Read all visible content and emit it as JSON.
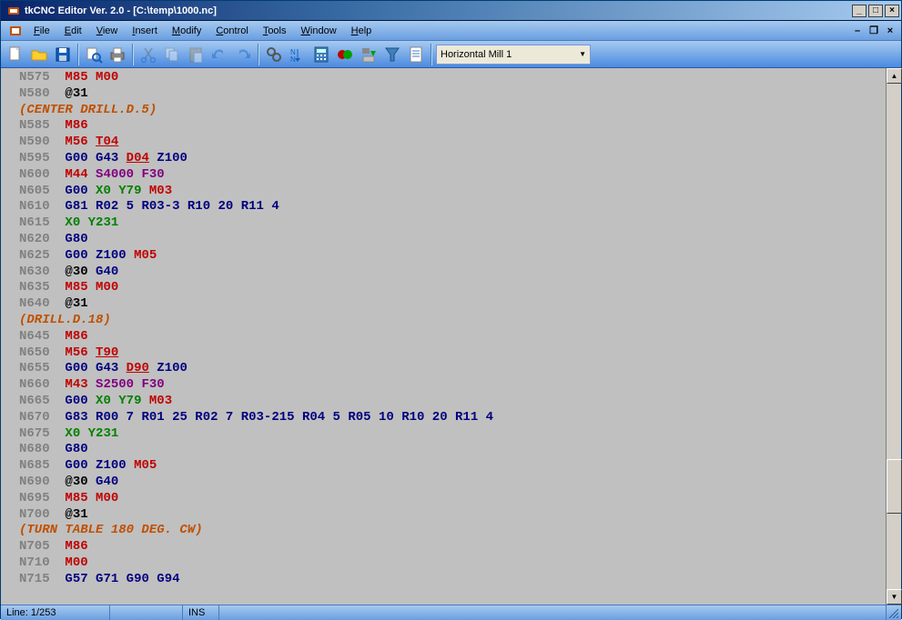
{
  "title": "tkCNC Editor Ver. 2.0 - [C:\\temp\\1000.nc]",
  "menu": {
    "file": "File",
    "edit": "Edit",
    "view": "View",
    "insert": "Insert",
    "modify": "Modify",
    "control": "Control",
    "tools": "Tools",
    "window": "Window",
    "help": "Help"
  },
  "combo": "Horizontal Mill 1",
  "status": {
    "line": "Line: 1/253",
    "ins": "INS"
  },
  "code": [
    [
      [
        "n",
        "N575"
      ],
      [
        "",
        "  "
      ],
      [
        "m",
        "M85"
      ],
      [
        "",
        " "
      ],
      [
        "m",
        "M00"
      ]
    ],
    [
      [
        "n",
        "N580"
      ],
      [
        "",
        "  "
      ],
      [
        "at",
        "@31"
      ]
    ],
    [
      [
        "cmt",
        "(CENTER DRILL.D.5)"
      ]
    ],
    [
      [
        "n",
        "N585"
      ],
      [
        "",
        "  "
      ],
      [
        "m",
        "M86"
      ]
    ],
    [
      [
        "n",
        "N590"
      ],
      [
        "",
        "  "
      ],
      [
        "m",
        "M56"
      ],
      [
        "",
        " "
      ],
      [
        "t",
        "T04"
      ]
    ],
    [
      [
        "n",
        "N595"
      ],
      [
        "",
        "  "
      ],
      [
        "g",
        "G00"
      ],
      [
        "",
        " "
      ],
      [
        "g",
        "G43"
      ],
      [
        "",
        " "
      ],
      [
        "d",
        "D04"
      ],
      [
        "",
        " "
      ],
      [
        "z",
        "Z100"
      ]
    ],
    [
      [
        "n",
        "N600"
      ],
      [
        "",
        "  "
      ],
      [
        "m",
        "M44"
      ],
      [
        "",
        " "
      ],
      [
        "s",
        "S4000"
      ],
      [
        "",
        " "
      ],
      [
        "f",
        "F30"
      ]
    ],
    [
      [
        "n",
        "N605"
      ],
      [
        "",
        "  "
      ],
      [
        "g",
        "G00"
      ],
      [
        "",
        " "
      ],
      [
        "x",
        "X0"
      ],
      [
        "",
        " "
      ],
      [
        "x",
        "Y79"
      ],
      [
        "",
        " "
      ],
      [
        "m",
        "M03"
      ]
    ],
    [
      [
        "n",
        "N610"
      ],
      [
        "",
        "  "
      ],
      [
        "g",
        "G81"
      ],
      [
        "",
        " "
      ],
      [
        "r",
        "R02 5"
      ],
      [
        "",
        " "
      ],
      [
        "r",
        "R03-3"
      ],
      [
        "",
        " "
      ],
      [
        "r",
        "R10 20"
      ],
      [
        "",
        " "
      ],
      [
        "r",
        "R11 4"
      ]
    ],
    [
      [
        "n",
        "N615"
      ],
      [
        "",
        "  "
      ],
      [
        "x",
        "X0"
      ],
      [
        "",
        " "
      ],
      [
        "x",
        "Y231"
      ]
    ],
    [
      [
        "n",
        "N620"
      ],
      [
        "",
        "  "
      ],
      [
        "g",
        "G80"
      ]
    ],
    [
      [
        "n",
        "N625"
      ],
      [
        "",
        "  "
      ],
      [
        "g",
        "G00"
      ],
      [
        "",
        " "
      ],
      [
        "z",
        "Z100"
      ],
      [
        "",
        " "
      ],
      [
        "m",
        "M05"
      ]
    ],
    [
      [
        "n",
        "N630"
      ],
      [
        "",
        "  "
      ],
      [
        "at",
        "@30"
      ],
      [
        "",
        " "
      ],
      [
        "g",
        "G40"
      ]
    ],
    [
      [
        "n",
        "N635"
      ],
      [
        "",
        "  "
      ],
      [
        "m",
        "M85"
      ],
      [
        "",
        " "
      ],
      [
        "m",
        "M00"
      ]
    ],
    [
      [
        "n",
        "N640"
      ],
      [
        "",
        "  "
      ],
      [
        "at",
        "@31"
      ]
    ],
    [
      [
        "cmt",
        "(DRILL.D.18)"
      ]
    ],
    [
      [
        "n",
        "N645"
      ],
      [
        "",
        "  "
      ],
      [
        "m",
        "M86"
      ]
    ],
    [
      [
        "n",
        "N650"
      ],
      [
        "",
        "  "
      ],
      [
        "m",
        "M56"
      ],
      [
        "",
        " "
      ],
      [
        "t",
        "T90"
      ]
    ],
    [
      [
        "n",
        "N655"
      ],
      [
        "",
        "  "
      ],
      [
        "g",
        "G00"
      ],
      [
        "",
        " "
      ],
      [
        "g",
        "G43"
      ],
      [
        "",
        " "
      ],
      [
        "d",
        "D90"
      ],
      [
        "",
        " "
      ],
      [
        "z",
        "Z100"
      ]
    ],
    [
      [
        "n",
        "N660"
      ],
      [
        "",
        "  "
      ],
      [
        "m",
        "M43"
      ],
      [
        "",
        " "
      ],
      [
        "s",
        "S2500"
      ],
      [
        "",
        " "
      ],
      [
        "f",
        "F30"
      ]
    ],
    [
      [
        "n",
        "N665"
      ],
      [
        "",
        "  "
      ],
      [
        "g",
        "G00"
      ],
      [
        "",
        " "
      ],
      [
        "x",
        "X0"
      ],
      [
        "",
        " "
      ],
      [
        "x",
        "Y79"
      ],
      [
        "",
        " "
      ],
      [
        "m",
        "M03"
      ]
    ],
    [
      [
        "n",
        "N670"
      ],
      [
        "",
        "  "
      ],
      [
        "g",
        "G83"
      ],
      [
        "",
        " "
      ],
      [
        "r",
        "R00 7"
      ],
      [
        "",
        " "
      ],
      [
        "r",
        "R01 25"
      ],
      [
        "",
        " "
      ],
      [
        "r",
        "R02 7"
      ],
      [
        "",
        " "
      ],
      [
        "r",
        "R03-215"
      ],
      [
        "",
        " "
      ],
      [
        "r",
        "R04 5"
      ],
      [
        "",
        " "
      ],
      [
        "r",
        "R05 10"
      ],
      [
        "",
        " "
      ],
      [
        "r",
        "R10 20"
      ],
      [
        "",
        " "
      ],
      [
        "r",
        "R11 4"
      ]
    ],
    [
      [
        "n",
        "N675"
      ],
      [
        "",
        "  "
      ],
      [
        "x",
        "X0"
      ],
      [
        "",
        " "
      ],
      [
        "x",
        "Y231"
      ]
    ],
    [
      [
        "n",
        "N680"
      ],
      [
        "",
        "  "
      ],
      [
        "g",
        "G80"
      ]
    ],
    [
      [
        "n",
        "N685"
      ],
      [
        "",
        "  "
      ],
      [
        "g",
        "G00"
      ],
      [
        "",
        " "
      ],
      [
        "z",
        "Z100"
      ],
      [
        "",
        " "
      ],
      [
        "m",
        "M05"
      ]
    ],
    [
      [
        "n",
        "N690"
      ],
      [
        "",
        "  "
      ],
      [
        "at",
        "@30"
      ],
      [
        "",
        " "
      ],
      [
        "g",
        "G40"
      ]
    ],
    [
      [
        "n",
        "N695"
      ],
      [
        "",
        "  "
      ],
      [
        "m",
        "M85"
      ],
      [
        "",
        " "
      ],
      [
        "m",
        "M00"
      ]
    ],
    [
      [
        "n",
        "N700"
      ],
      [
        "",
        "  "
      ],
      [
        "at",
        "@31"
      ]
    ],
    [
      [
        "cmt",
        "(TURN TABLE 180 DEG. CW)"
      ]
    ],
    [
      [
        "n",
        "N705"
      ],
      [
        "",
        "  "
      ],
      [
        "m",
        "M86"
      ]
    ],
    [
      [
        "n",
        "N710"
      ],
      [
        "",
        "  "
      ],
      [
        "m",
        "M00"
      ]
    ],
    [
      [
        "n",
        "N715"
      ],
      [
        "",
        "  "
      ],
      [
        "g",
        "G57"
      ],
      [
        "",
        " "
      ],
      [
        "g",
        "G71"
      ],
      [
        "",
        " "
      ],
      [
        "g",
        "G90"
      ],
      [
        "",
        " "
      ],
      [
        "g",
        "G94"
      ]
    ]
  ]
}
